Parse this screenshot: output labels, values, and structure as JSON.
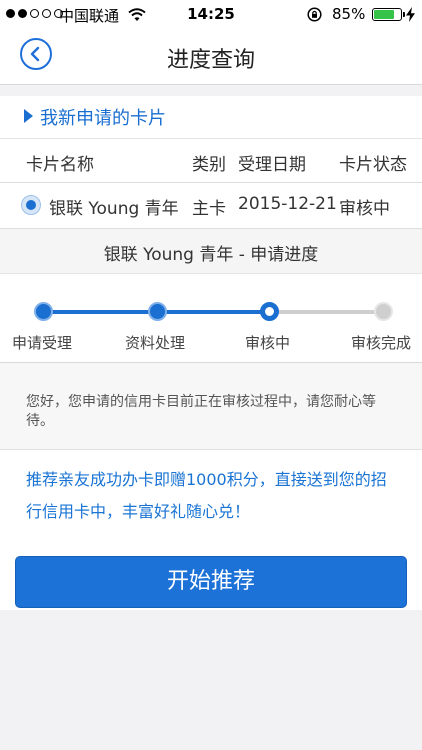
{
  "status_bar": {
    "carrier": "中国联通",
    "time": "14:25",
    "battery": "85%",
    "battery_level": 0.85,
    "signal_bars_filled": 2,
    "signal_bars_total": 5
  },
  "nav": {
    "title": "进度查询",
    "back_icon": "chevron-left-icon"
  },
  "card_section": {
    "title": "我新申请的卡片",
    "columns": [
      "卡片名称",
      "类别",
      "受理日期",
      "卡片状态"
    ],
    "row": {
      "name": "银联 Young 青年",
      "category": "主卡",
      "date": "2015-12-21",
      "status": "审核中"
    }
  },
  "progress": {
    "title": "银联 Young 青年 - 申请进度",
    "steps": [
      "申请受理",
      "资料处理",
      "审核中",
      "审核完成"
    ],
    "current_step": 3
  },
  "notice": "您好，您申请的信用卡目前正在审核过程中，请您耐心等待。",
  "promo": {
    "text": "推荐亲友成功办卡即赠1000积分，直接送到您的招行信用卡中，丰富好礼随心兑！",
    "button": "开始推荐"
  },
  "colors": {
    "accent": "#1a6fd1",
    "button": "#1d72d8",
    "battery": "#36c34a",
    "inactive": "#cfcfcf"
  }
}
